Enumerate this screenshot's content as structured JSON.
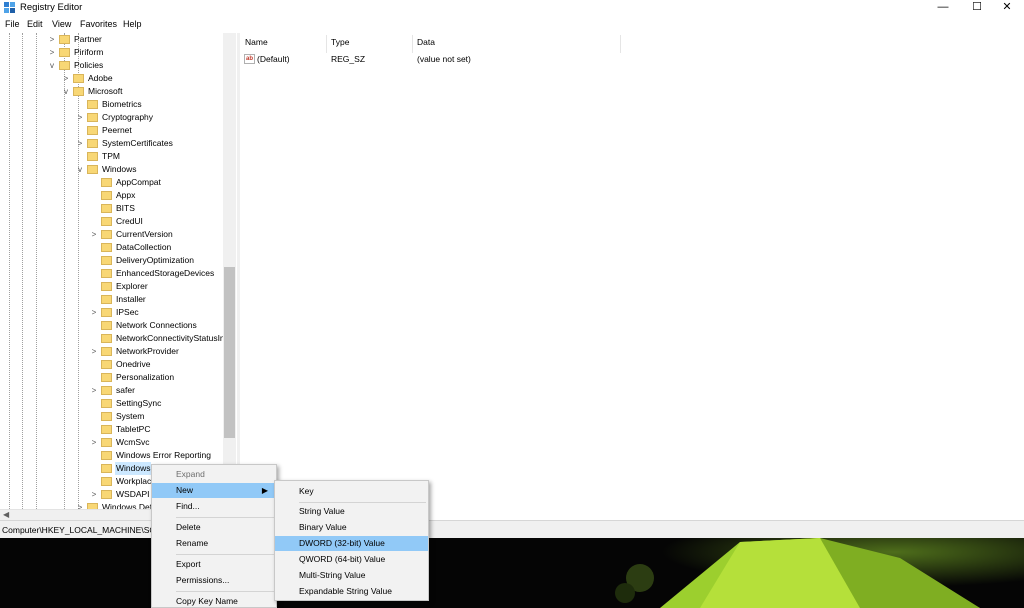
{
  "window": {
    "title": "Registry Editor",
    "controls": {
      "minimize": "—",
      "maximize": "☐",
      "close": "✕"
    }
  },
  "menu": [
    "File",
    "Edit",
    "View",
    "Favorites",
    "Help"
  ],
  "tree": [
    {
      "label": "Partner",
      "expand": ">"
    },
    {
      "label": "Piriform",
      "expand": ">"
    },
    {
      "label": "Policies",
      "expand": "v"
    },
    {
      "label": "Adobe",
      "expand": ">"
    },
    {
      "label": "Microsoft",
      "expand": "v"
    },
    {
      "label": "Biometrics",
      "expand": ""
    },
    {
      "label": "Cryptography",
      "expand": ">"
    },
    {
      "label": "Peernet",
      "expand": ""
    },
    {
      "label": "SystemCertificates",
      "expand": ">"
    },
    {
      "label": "TPM",
      "expand": ""
    },
    {
      "label": "Windows",
      "expand": "v"
    },
    {
      "label": "AppCompat",
      "expand": ""
    },
    {
      "label": "Appx",
      "expand": ""
    },
    {
      "label": "BITS",
      "expand": ""
    },
    {
      "label": "CredUI",
      "expand": ""
    },
    {
      "label": "CurrentVersion",
      "expand": ">"
    },
    {
      "label": "DataCollection",
      "expand": ""
    },
    {
      "label": "DeliveryOptimization",
      "expand": ""
    },
    {
      "label": "EnhancedStorageDevices",
      "expand": ""
    },
    {
      "label": "Explorer",
      "expand": ""
    },
    {
      "label": "Installer",
      "expand": ""
    },
    {
      "label": "IPSec",
      "expand": ">"
    },
    {
      "label": "Network Connections",
      "expand": ""
    },
    {
      "label": "NetworkConnectivityStatusIn",
      "expand": ""
    },
    {
      "label": "NetworkProvider",
      "expand": ">"
    },
    {
      "label": "Onedrive",
      "expand": ""
    },
    {
      "label": "Personalization",
      "expand": ""
    },
    {
      "label": "safer",
      "expand": ">"
    },
    {
      "label": "SettingSync",
      "expand": ""
    },
    {
      "label": "System",
      "expand": ""
    },
    {
      "label": "TabletPC",
      "expand": ""
    },
    {
      "label": "WcmSvc",
      "expand": ">"
    },
    {
      "label": "Windows Error Reporting",
      "expand": ""
    },
    {
      "label": "Windows",
      "expand": ""
    },
    {
      "label": "Workplace",
      "expand": ""
    },
    {
      "label": "WSDAPI",
      "expand": ">"
    },
    {
      "label": "Windows Def",
      "expand": ">"
    }
  ],
  "list": {
    "columns": [
      "Name",
      "Type",
      "Data"
    ],
    "rows": [
      {
        "name": "(Default)",
        "type": "REG_SZ",
        "data": "(value not set)"
      }
    ]
  },
  "status_path": "Computer\\HKEY_LOCAL_MACHINE\\SO",
  "context_menu": {
    "expand": "Expand",
    "new": "New",
    "find": "Find...",
    "delete": "Delete",
    "rename": "Rename",
    "export": "Export",
    "permissions": "Permissions...",
    "copy_key_name": "Copy Key Name"
  },
  "submenu": {
    "key": "Key",
    "string_value": "String Value",
    "binary_value": "Binary Value",
    "dword_value": "DWORD (32-bit) Value",
    "qword_value": "QWORD (64-bit) Value",
    "multi_string_value": "Multi-String Value",
    "expandable_string_value": "Expandable String Value"
  },
  "icons": {
    "app": "registry-editor-icon",
    "folder": "folder-icon",
    "string_value": "string-value-icon",
    "string_value_glyph": "ab"
  },
  "colors": {
    "highlight": "#91c9f7",
    "folder": "#f8d775",
    "selection": "#cce8ff"
  }
}
